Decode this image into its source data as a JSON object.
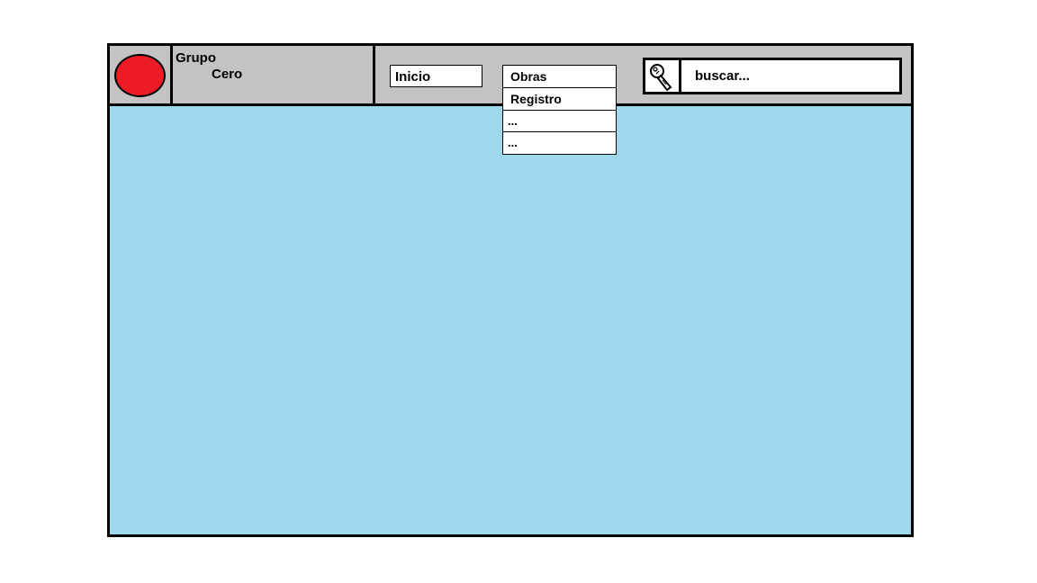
{
  "brand": {
    "line1": "Grupo",
    "line2": "Cero",
    "logo_color": "#ed1c24"
  },
  "nav": {
    "inicio_label": "Inicio",
    "dropdown_items": [
      "Obras",
      "Registro",
      "...",
      "..."
    ]
  },
  "search": {
    "placeholder": "buscar...",
    "icon": "search-icon"
  },
  "colors": {
    "header_bg": "#c3c3c3",
    "content_bg": "#9dd9ea",
    "border": "#000000"
  }
}
